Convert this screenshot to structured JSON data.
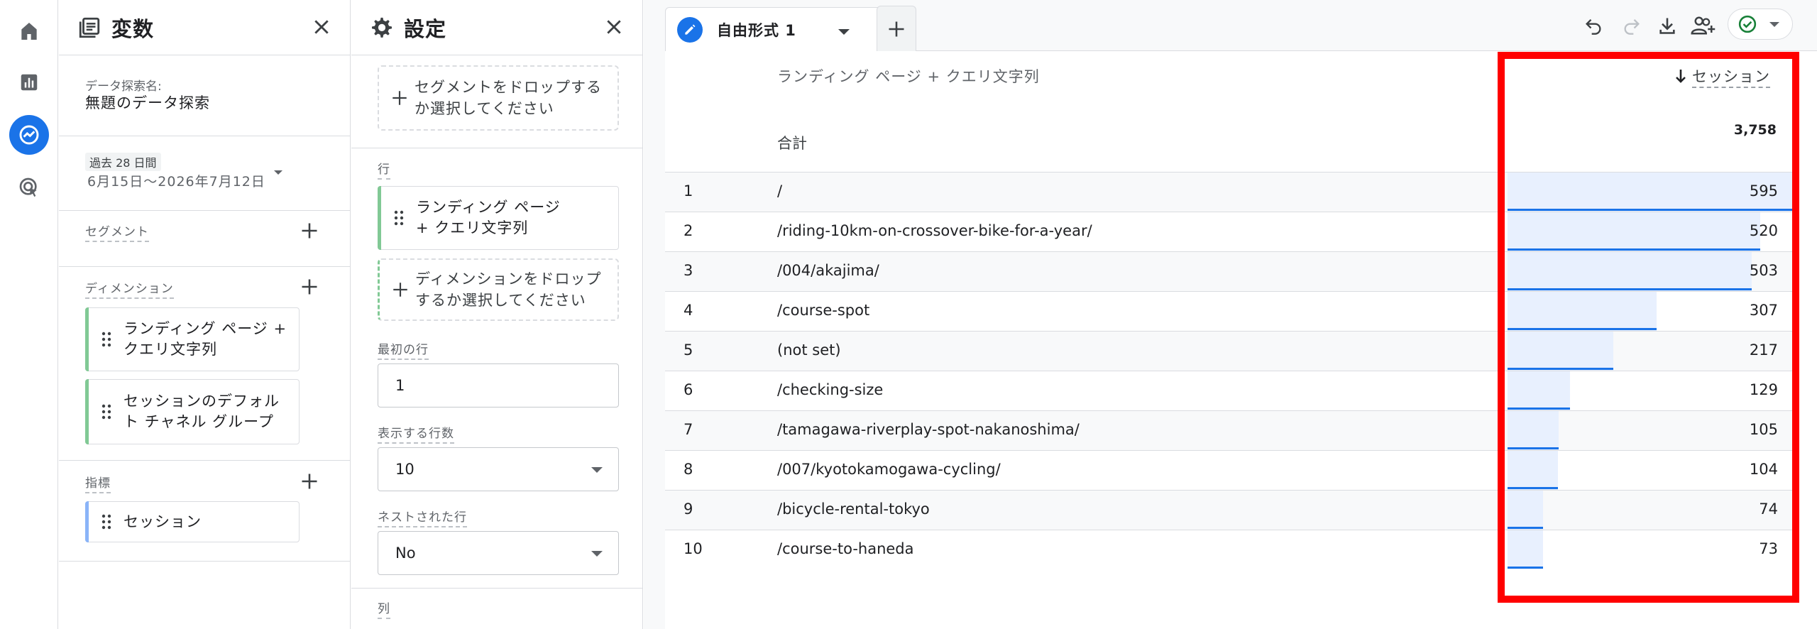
{
  "rail": {
    "items": [
      {
        "icon": "home-icon"
      },
      {
        "icon": "reports-icon"
      },
      {
        "icon": "explore-icon",
        "active": true
      },
      {
        "icon": "advertising-icon"
      }
    ]
  },
  "variables": {
    "title": "変数",
    "exploration_name_label": "データ探索名:",
    "exploration_name": "無題のデータ探索",
    "date_badge": "過去 28 日間",
    "date_range": "6月15日～2026年7月12日",
    "segments_label": "セグメント",
    "dimensions_label": "ディメンション",
    "dimensions": [
      "ランディング ページ + クエリ文字列",
      "セッションのデフォルト チャネル グループ"
    ],
    "metrics_label": "指標",
    "metrics": [
      "セッション"
    ]
  },
  "settings": {
    "title": "設定",
    "segment_drop": "セグメントをドロップするか選択してください",
    "rows_label": "行",
    "row_chip": "ランディング ページ + クエリ文字列",
    "dimension_drop": "ディメンションをドロップするか選択してください",
    "first_row_label": "最初の行",
    "first_row_value": "1",
    "show_rows_label": "表示する行数",
    "show_rows_value": "10",
    "nested_rows_label": "ネストされた行",
    "nested_rows_value": "No",
    "columns_label": "列"
  },
  "tab": {
    "label": "自由形式 1"
  },
  "table": {
    "dimension_header": "ランディング ページ + クエリ文字列",
    "metric_header": "セッション",
    "total_label": "合計",
    "total_value": "3,758",
    "rows": [
      {
        "num": "1",
        "dim": "/",
        "val": "595",
        "ratio": 1.0
      },
      {
        "num": "2",
        "dim": "/riding-10km-on-crossover-bike-for-a-year/",
        "val": "520",
        "ratio": 0.874
      },
      {
        "num": "3",
        "dim": "/004/akajima/",
        "val": "503",
        "ratio": 0.845
      },
      {
        "num": "4",
        "dim": "/course-spot",
        "val": "307",
        "ratio": 0.516
      },
      {
        "num": "5",
        "dim": "(not set)",
        "val": "217",
        "ratio": 0.365
      },
      {
        "num": "6",
        "dim": "/checking-size",
        "val": "129",
        "ratio": 0.217
      },
      {
        "num": "7",
        "dim": "/tamagawa-riverplay-spot-nakanoshima/",
        "val": "105",
        "ratio": 0.176
      },
      {
        "num": "8",
        "dim": "/007/kyotokamogawa-cycling/",
        "val": "104",
        "ratio": 0.175
      },
      {
        "num": "9",
        "dim": "/bicycle-rental-tokyo",
        "val": "74",
        "ratio": 0.124
      },
      {
        "num": "10",
        "dim": "/course-to-haneda",
        "val": "73",
        "ratio": 0.123
      }
    ]
  },
  "colors": {
    "accent": "#1a73e8",
    "bar_fill": "#e8f0fe",
    "dimension_chip": "#81c995",
    "metric_chip": "#8ab4f8",
    "highlight": "#ff0000",
    "status_check": "#188038"
  }
}
